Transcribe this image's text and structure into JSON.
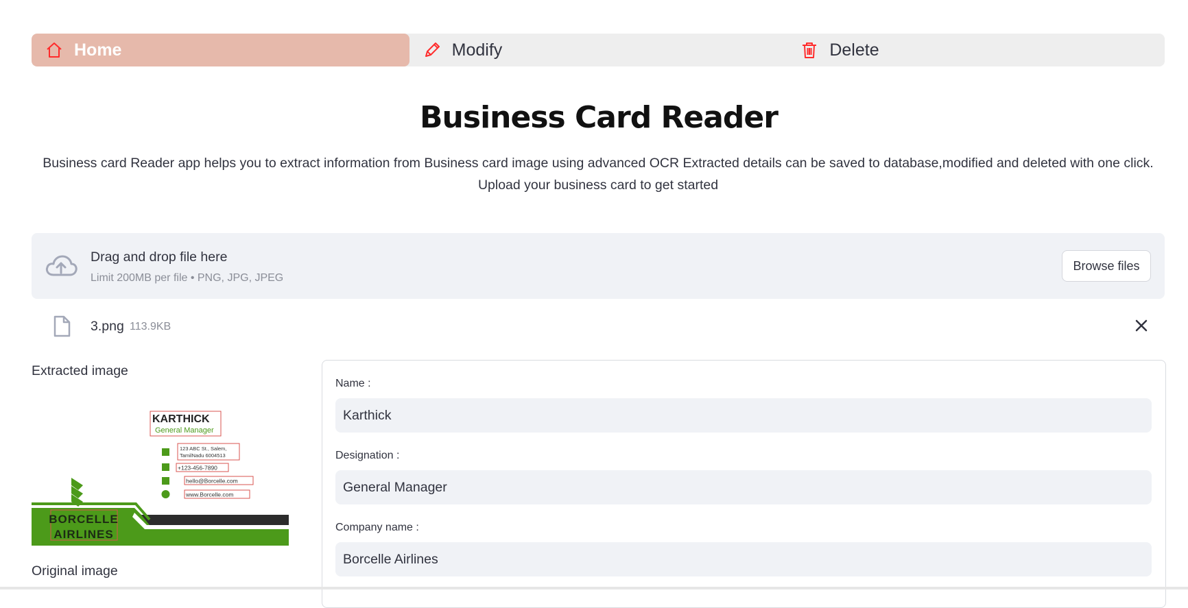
{
  "nav": {
    "items": [
      {
        "label": "Home",
        "icon": "house-icon",
        "active": true
      },
      {
        "label": "Modify",
        "icon": "pencil-icon",
        "active": false
      },
      {
        "label": "Delete",
        "icon": "trash-icon",
        "active": false
      }
    ],
    "active_color": "#e6b9ab",
    "icon_color": "#ff2b2b"
  },
  "header": {
    "title": "Business Card Reader",
    "description": "Business card Reader app helps you to extract information from Business card image using advanced OCR Extracted details can be saved to database,modified and deleted with one click. Upload your business card to get started"
  },
  "uploader": {
    "drop_text": "Drag and drop file here",
    "limit_text": "Limit 200MB per file • PNG, JPG, JPEG",
    "browse_label": "Browse files",
    "file": {
      "name": "3.png",
      "size": "113.9KB"
    }
  },
  "left": {
    "extracted_label": "Extracted image",
    "original_label": "Original image",
    "card": {
      "name": "KARTHICK",
      "title": "General Manager",
      "address_line1": "123 ABC St., Salem,",
      "address_line2": "TamilNadu 6004513",
      "phone": "+123-456-7890",
      "email": "hello@Borcelle.com",
      "website": "www.Borcelle.com",
      "company_line1": "BORCELLE",
      "company_line2": "AIRLINES"
    }
  },
  "form": {
    "name_label": "Name :",
    "name_value": "Karthick",
    "designation_label": "Designation :",
    "designation_value": "General Manager",
    "company_label": "Company name :",
    "company_value": "Borcelle Airlines"
  }
}
